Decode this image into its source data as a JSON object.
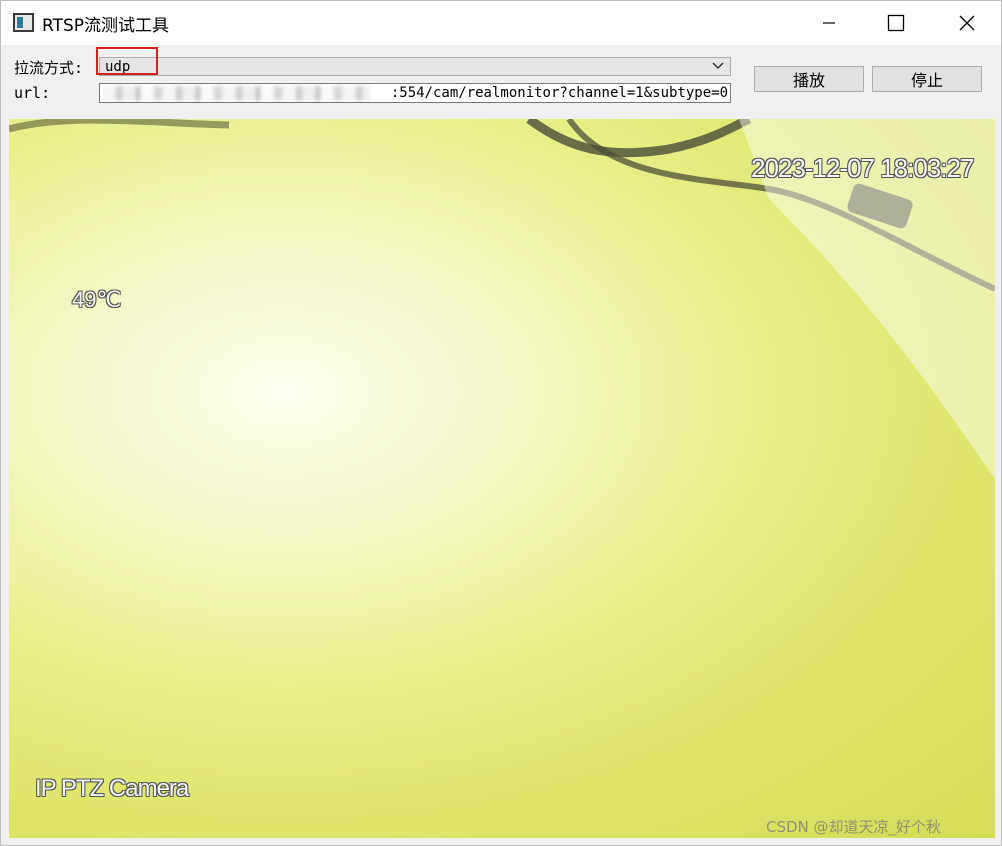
{
  "window": {
    "title": "RTSP流测试工具"
  },
  "controls": {
    "method_label": "拉流方式:",
    "method_value": "udp",
    "url_label": "url:",
    "url_value": ":554/cam/realmonitor?channel=1&subtype=0",
    "play_label": "播放",
    "stop_label": "停止"
  },
  "video": {
    "timestamp": "2023-12-07 18:03:27",
    "temperature": "49℃",
    "camera_name": "IP PTZ Camera",
    "watermark": "CSDN @却道天凉_好个秋"
  },
  "colors": {
    "highlight": "#d61f1f",
    "video_tint": "#e8ef8a"
  },
  "icons": [
    "app-icon",
    "minimize-icon",
    "maximize-icon",
    "close-icon",
    "chevron-down-icon"
  ]
}
